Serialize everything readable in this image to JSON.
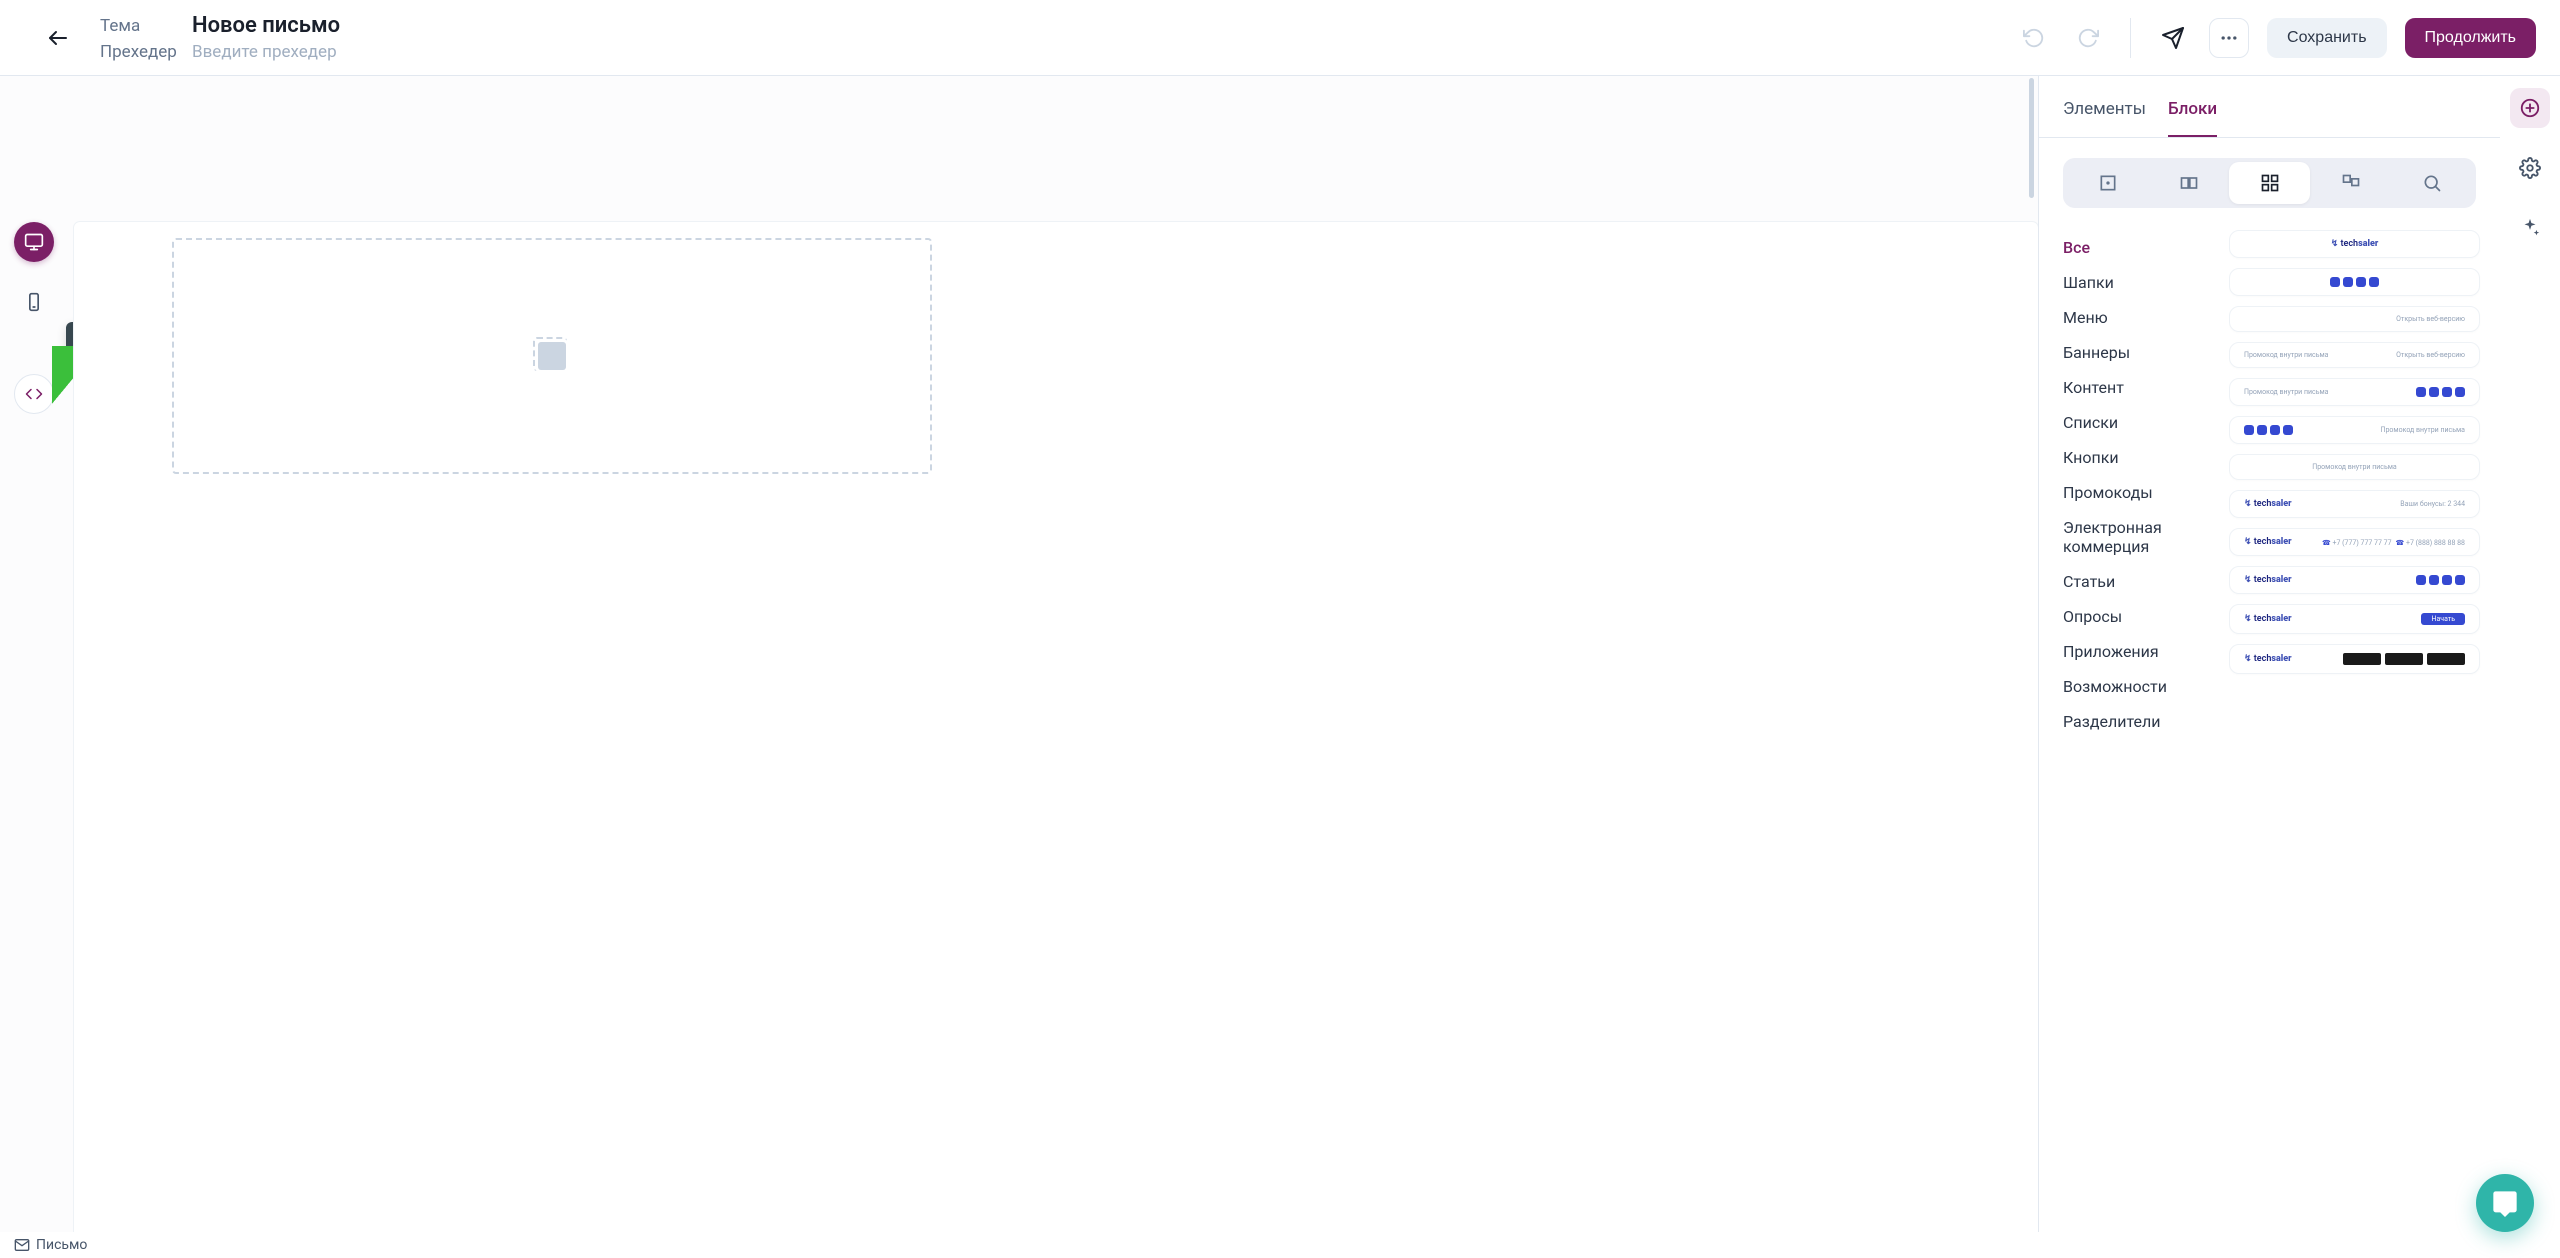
{
  "header": {
    "subject_label": "Тема",
    "subject_value": "Новое письмо",
    "preheader_label": "Прехедер",
    "preheader_placeholder": "Введите прехедер",
    "save_label": "Сохранить",
    "continue_label": "Продолжить"
  },
  "tooltip": {
    "code_mode": "Режим кода"
  },
  "panel": {
    "tab_elements": "Элементы",
    "tab_blocks": "Блоки",
    "categories": [
      "Все",
      "Шапки",
      "Меню",
      "Баннеры",
      "Контент",
      "Списки",
      "Кнопки",
      "Промокоды",
      "Электронная коммерция",
      "Статьи",
      "Опросы",
      "Приложения",
      "Возможности",
      "Разделители"
    ]
  },
  "thumbs": {
    "logo_a": "tech",
    "logo_b": "saler",
    "open_web": "Открыть веб-версию",
    "promo_inline": "Промокод внутри письма",
    "bonus_label": "Ваши бонусы: 2 344",
    "phone_1": "+7 (777) 777 77 77",
    "phone_2": "+7 (888) 888 88 88",
    "cta_start": "Начать"
  },
  "footer": {
    "letter": "Письмо"
  }
}
